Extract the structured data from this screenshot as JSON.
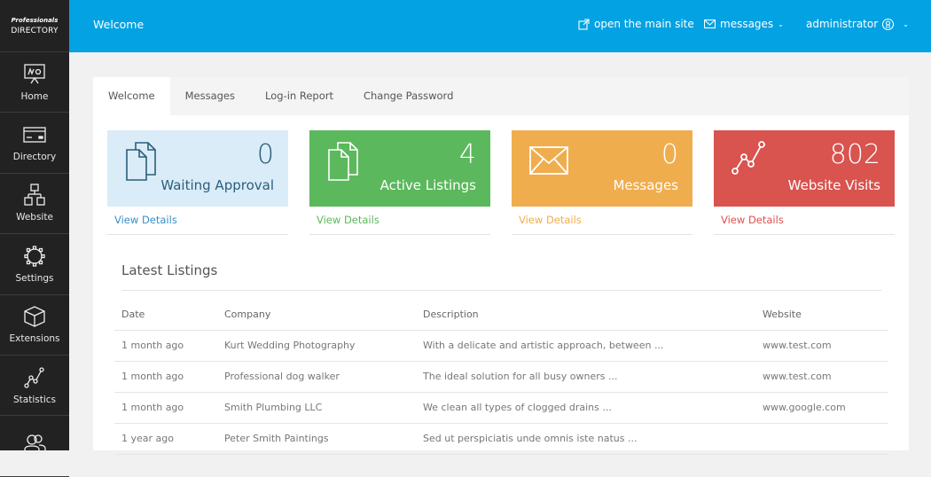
{
  "logo": {
    "line1": "Professionals",
    "line2": "DIRECTORY"
  },
  "sidebar": {
    "items": [
      {
        "label": "Home",
        "icon": "presentation-board-icon"
      },
      {
        "label": "Directory",
        "icon": "card-icon"
      },
      {
        "label": "Website",
        "icon": "sitemap-icon"
      },
      {
        "label": "Settings",
        "icon": "gear-icon"
      },
      {
        "label": "Extensions",
        "icon": "cube-icon"
      },
      {
        "label": "Statistics",
        "icon": "line-chart-icon"
      },
      {
        "label": "",
        "icon": "users-icon"
      }
    ]
  },
  "header": {
    "title": "Welcome",
    "open_site": "open the main site",
    "messages": "messages",
    "user": "administrator"
  },
  "tabs": [
    {
      "label": "Welcome",
      "active": true
    },
    {
      "label": "Messages",
      "active": false
    },
    {
      "label": "Log-in Report",
      "active": false
    },
    {
      "label": "Change Password",
      "active": false
    }
  ],
  "cards": [
    {
      "value": "0",
      "label": "Waiting Approval",
      "link": "View Details",
      "bg": "#d9ecf7",
      "fg": "#2c5e7a",
      "link_color": "#3a8fc4",
      "icon": "documents-icon"
    },
    {
      "value": "4",
      "label": "Active Listings",
      "link": "View Details",
      "bg": "#5cb85c",
      "fg": "#ffffff",
      "link_color": "#5cb85c",
      "icon": "documents-icon"
    },
    {
      "value": "0",
      "label": "Messages",
      "link": "View Details",
      "bg": "#f0ad4e",
      "fg": "#ffffff",
      "link_color": "#f0ad4e",
      "icon": "envelope-icon"
    },
    {
      "value": "802",
      "label": "Website Visits",
      "link": "View Details",
      "bg": "#d9534f",
      "fg": "#ffffff",
      "link_color": "#d9534f",
      "icon": "line-chart-icon"
    }
  ],
  "listings": {
    "title": "Latest Listings",
    "columns": [
      "Date",
      "Company",
      "Description",
      "Website"
    ],
    "rows": [
      [
        "1 month ago",
        "Kurt Wedding Photography",
        "With a delicate and artistic approach, between ...",
        "www.test.com"
      ],
      [
        "1 month ago",
        "Professional dog walker",
        "The ideal solution for all busy owners ...",
        "www.test.com"
      ],
      [
        "1 month ago",
        "Smith Plumbing LLC",
        "We clean all types of clogged drains ...",
        "www.google.com"
      ],
      [
        "1 year ago",
        "Peter Smith Paintings",
        "Sed ut perspiciatis unde omnis iste natus ...",
        ""
      ]
    ]
  }
}
